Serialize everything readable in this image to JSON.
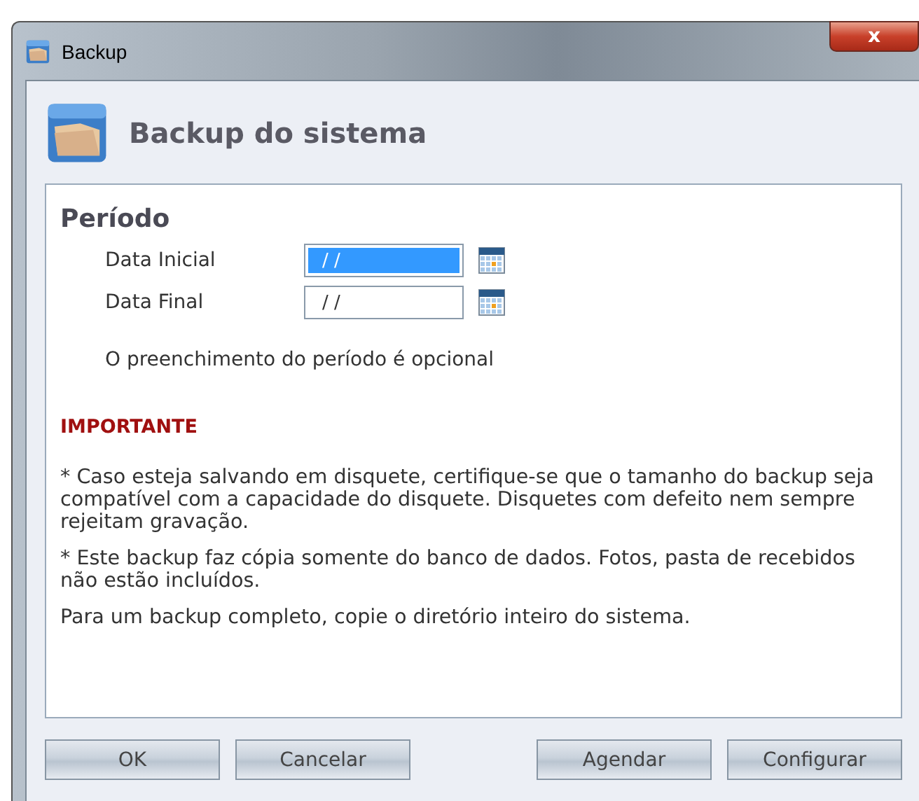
{
  "window": {
    "title": "Backup",
    "close": "x"
  },
  "header": {
    "title": "Backup do sistema"
  },
  "period": {
    "title": "Período",
    "fields": [
      {
        "label": "Data Inicial",
        "value": "/ /",
        "focused": true
      },
      {
        "label": "Data Final",
        "value": "/ /",
        "focused": false
      }
    ],
    "note": "O preenchimento do período é opcional"
  },
  "important": {
    "title": "IMPORTANTE",
    "paragraphs": [
      "* Caso esteja salvando em disquete, certifique-se que o tamanho do backup seja compatível com a capacidade do disquete. Disquetes com defeito nem sempre rejeitam gravação.",
      "* Este backup faz cópia somente do banco de dados. Fotos, pasta de recebidos não estão incluídos.",
      "Para um backup completo, copie o diretório inteiro do sistema."
    ]
  },
  "buttons_left": [
    "OK",
    "Cancelar"
  ],
  "buttons_right": [
    "Agendar",
    "Configurar"
  ]
}
